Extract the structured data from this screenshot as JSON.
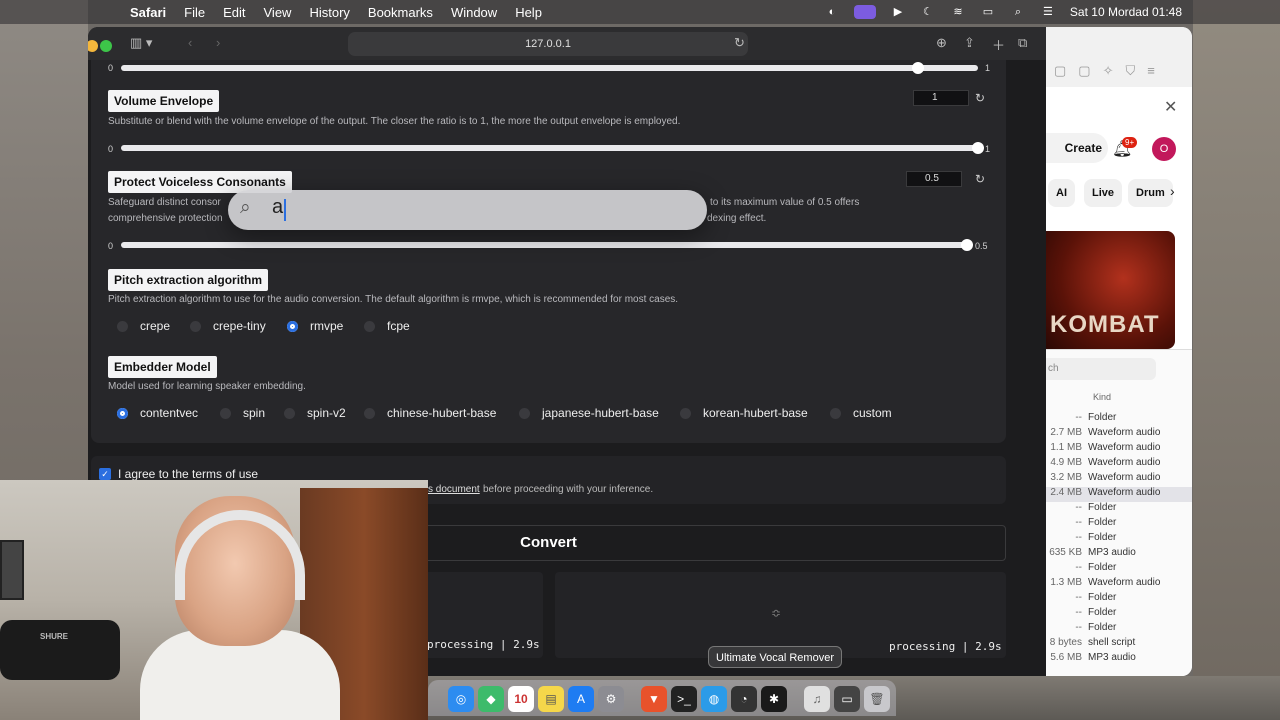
{
  "menubar": {
    "app": "Safari",
    "items": [
      "File",
      "Edit",
      "View",
      "History",
      "Bookmarks",
      "Window",
      "Help"
    ],
    "clock": "Sat 10 Mordad 01:48"
  },
  "browser": {
    "url": "127.0.0.1"
  },
  "top_slider": {
    "min": "0",
    "max": "1",
    "value": 0.93
  },
  "volume_envelope": {
    "label": "Volume Envelope",
    "description": "Substitute or blend with the volume envelope of the output. The closer the ratio is to 1, the more the output envelope is employed.",
    "min": "0",
    "max": "1",
    "value": "1",
    "fraction": 1.0
  },
  "protect_voiceless": {
    "label": "Protect Voiceless Consonants",
    "description_left_1": "Safeguard distinct consor",
    "description_right_1": "to its maximum value of 0.5 offers",
    "description_left_2": "comprehensive protection",
    "description_right_2": "dexing effect.",
    "min": "0",
    "max": "0.5",
    "value": "0.5",
    "fraction": 1.0
  },
  "pitch": {
    "label": "Pitch extraction algorithm",
    "description": "Pitch extraction algorithm to use for the audio conversion. The default algorithm is rmvpe, which is recommended for most cases.",
    "options": [
      "crepe",
      "crepe-tiny",
      "rmvpe",
      "fcpe"
    ],
    "selected": "rmvpe"
  },
  "embedder": {
    "label": "Embedder Model",
    "description": "Model used for learning speaker embedding.",
    "options": [
      "contentvec",
      "spin",
      "spin-v2",
      "chinese-hubert-base",
      "japanese-hubert-base",
      "korean-hubert-base",
      "custom"
    ],
    "selected": "contentvec"
  },
  "terms": {
    "checkbox_label": "I agree to the terms of use",
    "link": "s document",
    "after_link": "before proceeding with your inference.",
    "checked": true
  },
  "convert_label": "Convert",
  "outputs": {
    "left_status": "processing | 2.9s",
    "right_status": "processing | 2.9s"
  },
  "spotlight": {
    "query": "a"
  },
  "dock": {
    "tooltip": "Ultimate Vocal Remover",
    "calendar_day": "10"
  },
  "right_window": {
    "create": "Create",
    "badge": "9+",
    "avatar": "O",
    "chips": [
      "AI",
      "Live",
      "Drum"
    ],
    "thumb_text": "KOMBAT",
    "search_placeholder": "ch",
    "kind_header": "Kind",
    "rows": [
      {
        "size": "--",
        "kind": "Folder"
      },
      {
        "size": "2.7 MB",
        "kind": "Waveform audio"
      },
      {
        "size": "1.1 MB",
        "kind": "Waveform audio"
      },
      {
        "size": "4.9 MB",
        "kind": "Waveform audio"
      },
      {
        "size": "3.2 MB",
        "kind": "Waveform audio"
      },
      {
        "size": "2.4 MB",
        "kind": "Waveform audio"
      },
      {
        "size": "--",
        "kind": "Folder"
      },
      {
        "size": "--",
        "kind": "Folder"
      },
      {
        "size": "--",
        "kind": "Folder"
      },
      {
        "size": "635 KB",
        "kind": "MP3 audio"
      },
      {
        "size": "--",
        "kind": "Folder"
      },
      {
        "size": "1.3 MB",
        "kind": "Waveform audio"
      },
      {
        "size": "--",
        "kind": "Folder"
      },
      {
        "size": "--",
        "kind": "Folder"
      },
      {
        "size": "--",
        "kind": "Folder"
      },
      {
        "size": "8 bytes",
        "kind": "shell script"
      },
      {
        "size": "5.6 MB",
        "kind": "MP3 audio"
      }
    ],
    "selected_row": 5
  },
  "colors": {
    "accent": "#2b6fe0",
    "panel": "#27272a",
    "background": "#1c1c1e"
  }
}
